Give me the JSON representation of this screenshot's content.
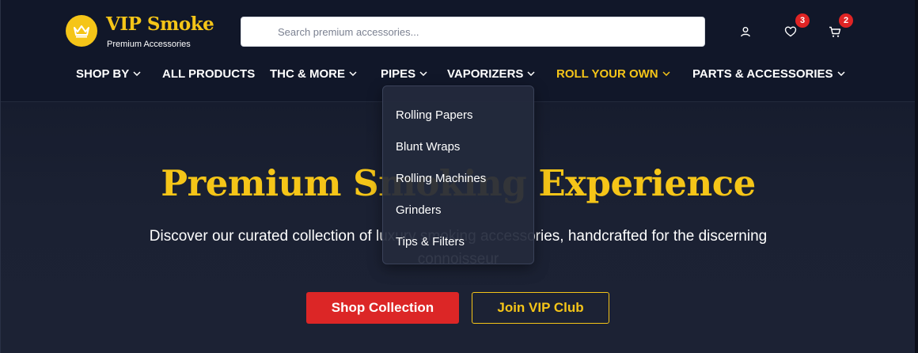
{
  "brand": {
    "name": "VIP Smoke",
    "tagline": "Premium Accessories",
    "accent_color": "#f5c518",
    "logo_icon": "crown-icon"
  },
  "search": {
    "placeholder": "Search premium accessories...",
    "value": ""
  },
  "header_actions": {
    "account_icon": "user-icon",
    "wishlist_icon": "heart-icon",
    "wishlist_count": "3",
    "cart_icon": "cart-icon",
    "cart_count": "2",
    "badge_color": "#e02424"
  },
  "nav": {
    "items": [
      {
        "label": "SHOP BY",
        "has_dropdown": true
      },
      {
        "label": "ALL PRODUCTS",
        "has_dropdown": false
      },
      {
        "label": "THC & MORE",
        "has_dropdown": true
      },
      {
        "label": "PIPES",
        "has_dropdown": true
      },
      {
        "label": "VAPORIZERS",
        "has_dropdown": true
      },
      {
        "label": "ROLL YOUR OWN",
        "has_dropdown": true,
        "active": true
      },
      {
        "label": "PARTS & ACCESSORIES",
        "has_dropdown": true
      }
    ]
  },
  "dropdown": {
    "items": [
      "Rolling Papers",
      "Blunt Wraps",
      "Rolling Machines",
      "Grinders",
      "Tips & Filters"
    ]
  },
  "hero": {
    "title": "Premium Smoking Experience",
    "subtitle": "Discover our curated collection of luxury smoking accessories, handcrafted for the discerning connoisseur",
    "primary_button": "Shop Collection",
    "secondary_button": "Join VIP Club",
    "primary_color": "#dc2626"
  }
}
